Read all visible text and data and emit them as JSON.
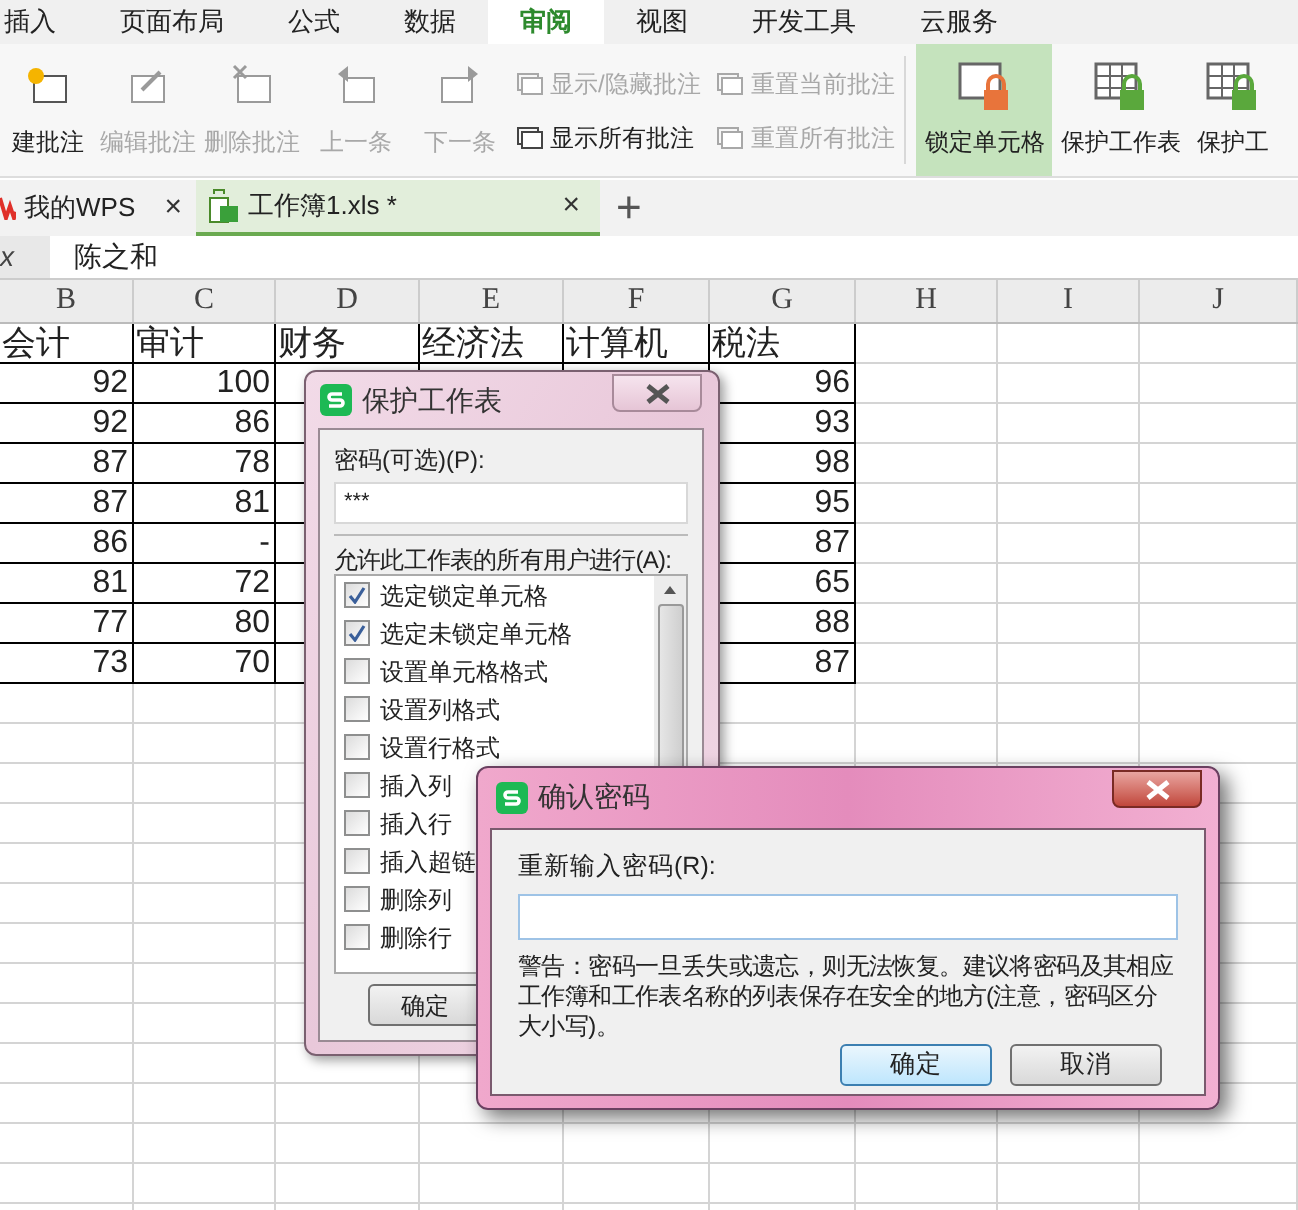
{
  "ribbon_tabs": [
    {
      "label": "插入",
      "selected": false
    },
    {
      "label": "页面布局",
      "selected": false
    },
    {
      "label": "公式",
      "selected": false
    },
    {
      "label": "数据",
      "selected": false
    },
    {
      "label": "审阅",
      "selected": true
    },
    {
      "label": "视图",
      "selected": false
    },
    {
      "label": "开发工具",
      "selected": false
    },
    {
      "label": "云服务",
      "selected": false
    }
  ],
  "ribbon_large_buttons": [
    {
      "label": "建批注",
      "disabled": false
    },
    {
      "label": "编辑批注",
      "disabled": true
    },
    {
      "label": "删除批注",
      "disabled": true
    },
    {
      "label": "上一条",
      "disabled": true
    },
    {
      "label": "下一条",
      "disabled": true
    }
  ],
  "ribbon_small_buttons": [
    {
      "label": "显示/隐藏批注",
      "disabled": true
    },
    {
      "label": "显示所有批注",
      "disabled": false
    },
    {
      "label": "重置当前批注",
      "disabled": true
    },
    {
      "label": "重置所有批注",
      "disabled": true
    }
  ],
  "ribbon_protect_buttons": [
    {
      "label": "锁定单元格",
      "selected": true
    },
    {
      "label": "保护工作表",
      "selected": false
    },
    {
      "label": "保护工",
      "selected": false
    }
  ],
  "document_tabs": [
    {
      "label": "我的WPS",
      "selected": false,
      "close": "×"
    },
    {
      "label": "工作簿1.xls *",
      "selected": true,
      "close": "×"
    }
  ],
  "new_tab": "+",
  "formula_bar": {
    "fx": "x",
    "value": "陈之和"
  },
  "sheet": {
    "columns": [
      "B",
      "C",
      "D",
      "E",
      "F",
      "G",
      "H",
      "I",
      "J"
    ],
    "rows": [
      {
        "B": "会计",
        "C": "审计",
        "D": "财务",
        "E": "经济法",
        "F": "计算机",
        "G": "税法"
      },
      {
        "B": "92",
        "C": "100",
        "G": "96"
      },
      {
        "B": "92",
        "C": "86",
        "G": "93"
      },
      {
        "B": "87",
        "C": "78",
        "G": "98"
      },
      {
        "B": "87",
        "C": "81",
        "G": "95"
      },
      {
        "B": "86",
        "C": "-",
        "G": "87"
      },
      {
        "B": "81",
        "C": "72",
        "G": "65"
      },
      {
        "B": "77",
        "C": "80",
        "G": "88"
      },
      {
        "B": "73",
        "C": "70",
        "G": "87"
      }
    ]
  },
  "protect_dialog": {
    "title": "保护工作表",
    "password_label": "密码(可选)(P):",
    "password_value": "***",
    "permissions_label": "允许此工作表的所有用户进行(A):",
    "permissions": [
      {
        "label": "选定锁定单元格",
        "checked": true
      },
      {
        "label": "选定未锁定单元格",
        "checked": true
      },
      {
        "label": "设置单元格格式",
        "checked": false
      },
      {
        "label": "设置列格式",
        "checked": false
      },
      {
        "label": "设置行格式",
        "checked": false
      },
      {
        "label": "插入列",
        "checked": false
      },
      {
        "label": "插入行",
        "checked": false
      },
      {
        "label": "插入超链",
        "checked": false
      },
      {
        "label": "删除列",
        "checked": false
      },
      {
        "label": "删除行",
        "checked": false
      }
    ],
    "ok": "确定"
  },
  "confirm_dialog": {
    "title": "确认密码",
    "reenter_label": "重新输入密码(R):",
    "warning": "警告：密码一旦丢失或遗忘，则无法恢复。建议将密码及其相应工作簿和工作表名称的列表保存在安全的地方(注意，密码区分大小写)。",
    "ok": "确定",
    "cancel": "取消"
  }
}
